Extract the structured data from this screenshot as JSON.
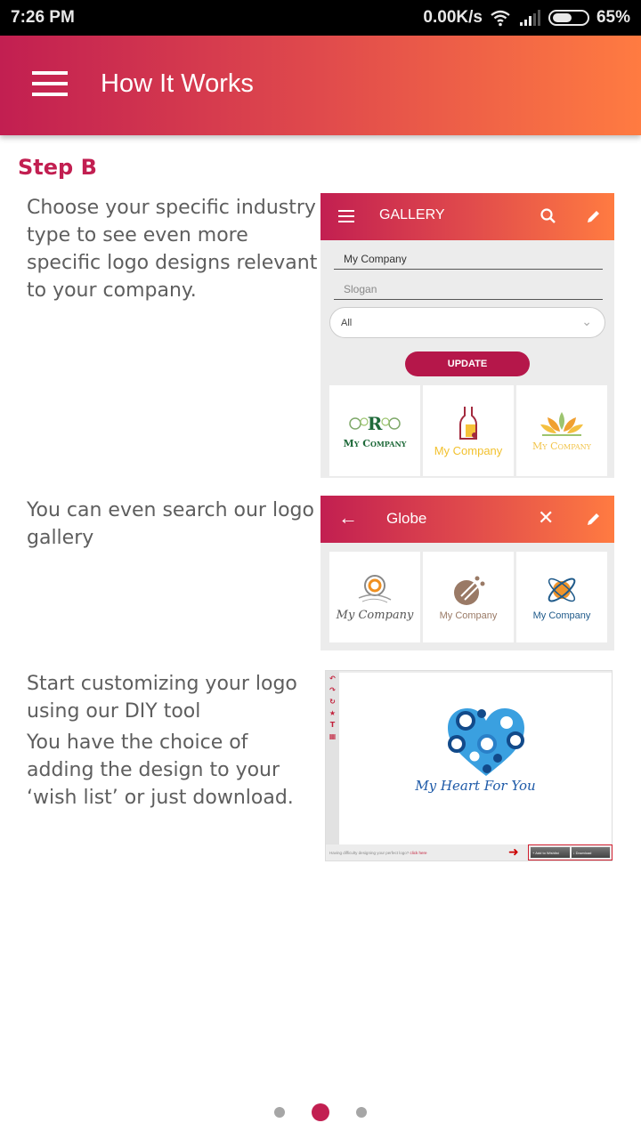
{
  "status_bar": {
    "time": "7:26 PM",
    "network_speed": "0.00K/s",
    "battery": "65%",
    "battery_level": 0.65,
    "icons": [
      "wifi-icon",
      "signal-icon",
      "battery-icon"
    ]
  },
  "app_bar": {
    "title": "How It Works",
    "menu_icon": "menu-icon",
    "gradient_start": "#c21f51",
    "gradient_end": "#ff7b41"
  },
  "step": {
    "title": "Step B",
    "sections": [
      {
        "paragraphs": [
          "Choose your specific industry type to see even more specific logo designs relevant to your company."
        ],
        "screenshot": {
          "bar_title": "GALLERY",
          "bar_icons": [
            "menu-icon",
            "search-icon",
            "pencil-icon"
          ],
          "company_field": "My Company",
          "slogan_placeholder": "Slogan",
          "industry_select": "All",
          "update_button": "UPDATE",
          "logos": [
            {
              "text": "My Company",
              "color": "#1f6a3a"
            },
            {
              "text": "My Company",
              "color": "#f2c12e"
            },
            {
              "text": "My Company",
              "color": "#f2c44a"
            }
          ]
        }
      },
      {
        "paragraphs": [
          "You can even search our logo gallery"
        ],
        "screenshot": {
          "bar_title": "Globe",
          "bar_icons": [
            "back-arrow-icon",
            "close-icon",
            "pencil-icon"
          ],
          "logos": [
            {
              "text": "My Company",
              "color": "#555555"
            },
            {
              "text": "My Company",
              "color": "#9a7a66"
            },
            {
              "text": "My Company",
              "color": "#1f5a8a"
            }
          ]
        }
      },
      {
        "paragraphs": [
          "Start customizing your logo using our DIY tool",
          "You have the choice of adding the design to your ‘wish list’ or just download."
        ],
        "screenshot": {
          "tools": [
            "↶",
            "↷",
            "↻",
            "★",
            "T",
            "▦"
          ],
          "logo_text": "My Heart For You",
          "footer_text": "Having difficulty designing your perfect logo?",
          "footer_link": "click here",
          "wishlist_button": "+ Add to Wishlist",
          "download_button": "↓ Download"
        }
      }
    ]
  },
  "pager": {
    "total": 3,
    "active_index": 1,
    "active_color": "#c21f51"
  }
}
